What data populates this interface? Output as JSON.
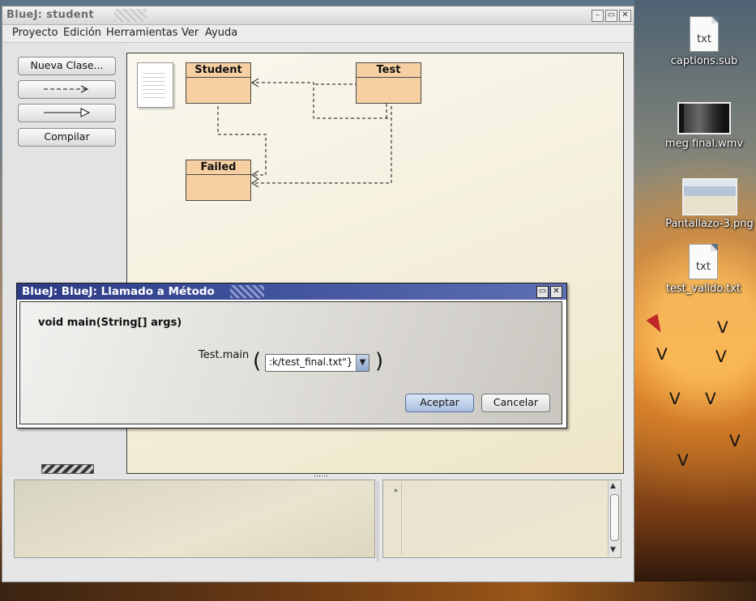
{
  "window": {
    "title": "BlueJ:  student",
    "controls": [
      "minimize",
      "maximize",
      "close"
    ]
  },
  "menu": [
    "Proyecto",
    "Edición",
    "Herramientas",
    "Ver",
    "Ayuda"
  ],
  "tools": {
    "new_class": "Nueva Clase...",
    "dependency_arrow": "--->",
    "inheritance_arrow": "—▷",
    "compile": "Compilar"
  },
  "classes": {
    "student": "Student",
    "test": "Test",
    "failed": "Failed"
  },
  "dialog": {
    "title": "BlueJ:  BlueJ:  Llamado a Método",
    "signature": "void main(String[] args)",
    "method_label": "Test.main",
    "open_paren": "(",
    "close_paren": ")",
    "argument_value": ":k/test_final.txt\"}",
    "ok": "Aceptar",
    "cancel": "Cancelar"
  },
  "desktop_icons": [
    {
      "label": "captions.sub",
      "type": "txt",
      "glyph": "txt"
    },
    {
      "label": "meg final.wmv",
      "type": "video"
    },
    {
      "label": "Pantallazo-3.png",
      "type": "image"
    },
    {
      "label": "test_valido.txt",
      "type": "txt",
      "glyph": "txt"
    }
  ],
  "colors": {
    "class_fill": "#f6cfa2",
    "dialog_title": "#2b3a82",
    "canvas_bg": "#f4efdc"
  }
}
